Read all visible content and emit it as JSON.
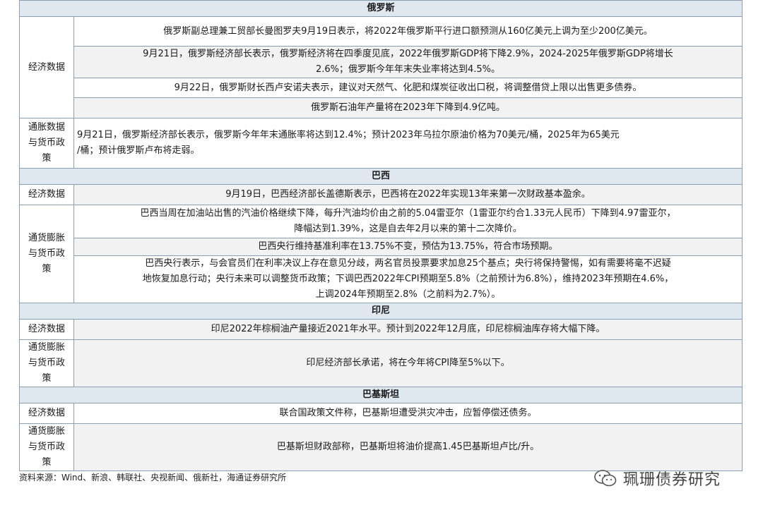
{
  "sections": [
    {
      "country": "俄罗斯",
      "rows": [
        {
          "category": "经济数据",
          "items": [
            {
              "lines": [
                "俄罗斯副总理兼工贸部长曼图罗夫9月19日表示，将2022年俄罗斯平行进口额预测从160亿美元上调为至少200亿美元。"
              ]
            },
            {
              "lines": [
                "9月21日，俄罗斯经济部长表示，俄罗斯经济将在四季度见底，2022年俄罗斯GDP将下降2.9%，2024-2025年俄罗斯GDP将增长",
                "2.6%；俄罗斯今年年末失业率将达到4.5%。"
              ]
            },
            {
              "lines": [
                "9月22日，俄罗斯财长西卢安诺夫表示，建议对天然气、化肥和煤炭征收出口税，将调整借贷上限以出售更多债券。"
              ]
            },
            {
              "lines": [
                "俄罗斯石油年产量将在2023年下降到4.9亿吨。"
              ]
            }
          ]
        },
        {
          "category": "通胀数据与货币政策",
          "category_lines": [
            "通胀数据",
            "与货币政",
            "策"
          ],
          "items": [
            {
              "lines": [
                "9月21日，俄罗斯经济部长表示，俄罗斯今年年末通胀率将达到12.4%；预计2023年乌拉尔原油价格为70美元/桶，2025年为65美元",
                "/桶；预计俄罗斯卢布将走弱。"
              ]
            }
          ]
        }
      ]
    },
    {
      "country": "巴西",
      "rows": [
        {
          "category": "经济数据",
          "items": [
            {
              "lines": [
                "9月19日，巴西经济部长盖德斯表示，巴西将在2022年实现13年来第一次财政基本盈余。"
              ]
            }
          ]
        },
        {
          "category": "通货膨胀与货币政策",
          "category_lines": [
            "通货膨胀",
            "与货币政",
            "策"
          ],
          "items": [
            {
              "lines": [
                "巴西当周在加油站出售的汽油价格继续下降，每升汽油均价由之前的5.04雷亚尔（1雷亚尔约合1.33元人民币）下降到4.97雷亚尔，",
                "降幅达到1.39%，这是自去年2月以来的第十二次降价。"
              ]
            },
            {
              "lines": [
                "巴西央行维持基准利率在13.75%不变，预估为13.75%，符合市场预期。"
              ]
            },
            {
              "lines": [
                "巴西央行表示，与会官员们在利率决议上存在意见分歧，两名官员投票要求加息25个基点；央行将保持警惕，如有需要将毫不迟疑",
                "地恢复加息行动；央行未来可以调整货币政策；下调巴西2022年CPI预期至5.8%（之前预计为6.8%），维持2023年预期在4.6%，",
                "上调2024年预期至2.8%（之前料为2.7%）。"
              ]
            }
          ]
        }
      ]
    },
    {
      "country": "印尼",
      "rows": [
        {
          "category": "经济数据",
          "items": [
            {
              "lines": [
                "印尼2022年棕榈油产量接近2021年水平。预计到2022年12月底，印尼棕榈油库存将大幅下降。"
              ]
            }
          ]
        },
        {
          "category": "通货膨胀与货币政策",
          "category_lines": [
            "通货膨胀",
            "与货币政",
            "策"
          ],
          "items": [
            {
              "lines": [
                "印尼经济部长承诺，将在今年将CPI降至5%以下。"
              ]
            }
          ]
        }
      ]
    },
    {
      "country": "巴基斯坦",
      "rows": [
        {
          "category": "经济数据",
          "items": [
            {
              "lines": [
                "联合国政策文件称，巴基斯坦遭受洪灾冲击，应暂停偿还债务。"
              ]
            }
          ]
        },
        {
          "category": "通货膨胀与货币政策",
          "category_lines": [
            "通货膨胀",
            "与货币政",
            "策"
          ],
          "items": [
            {
              "lines": [
                "巴基斯坦财政部称，巴基斯坦将油价提高1.45巴基斯坦卢比/升。"
              ]
            }
          ]
        }
      ]
    }
  ],
  "footer": "资料来源：Wind、新浪、韩联社、央视新闻、俄新社，海通证券研究所",
  "watermark": "珮珊债券研究",
  "watermark_icon": "wechat-icon"
}
